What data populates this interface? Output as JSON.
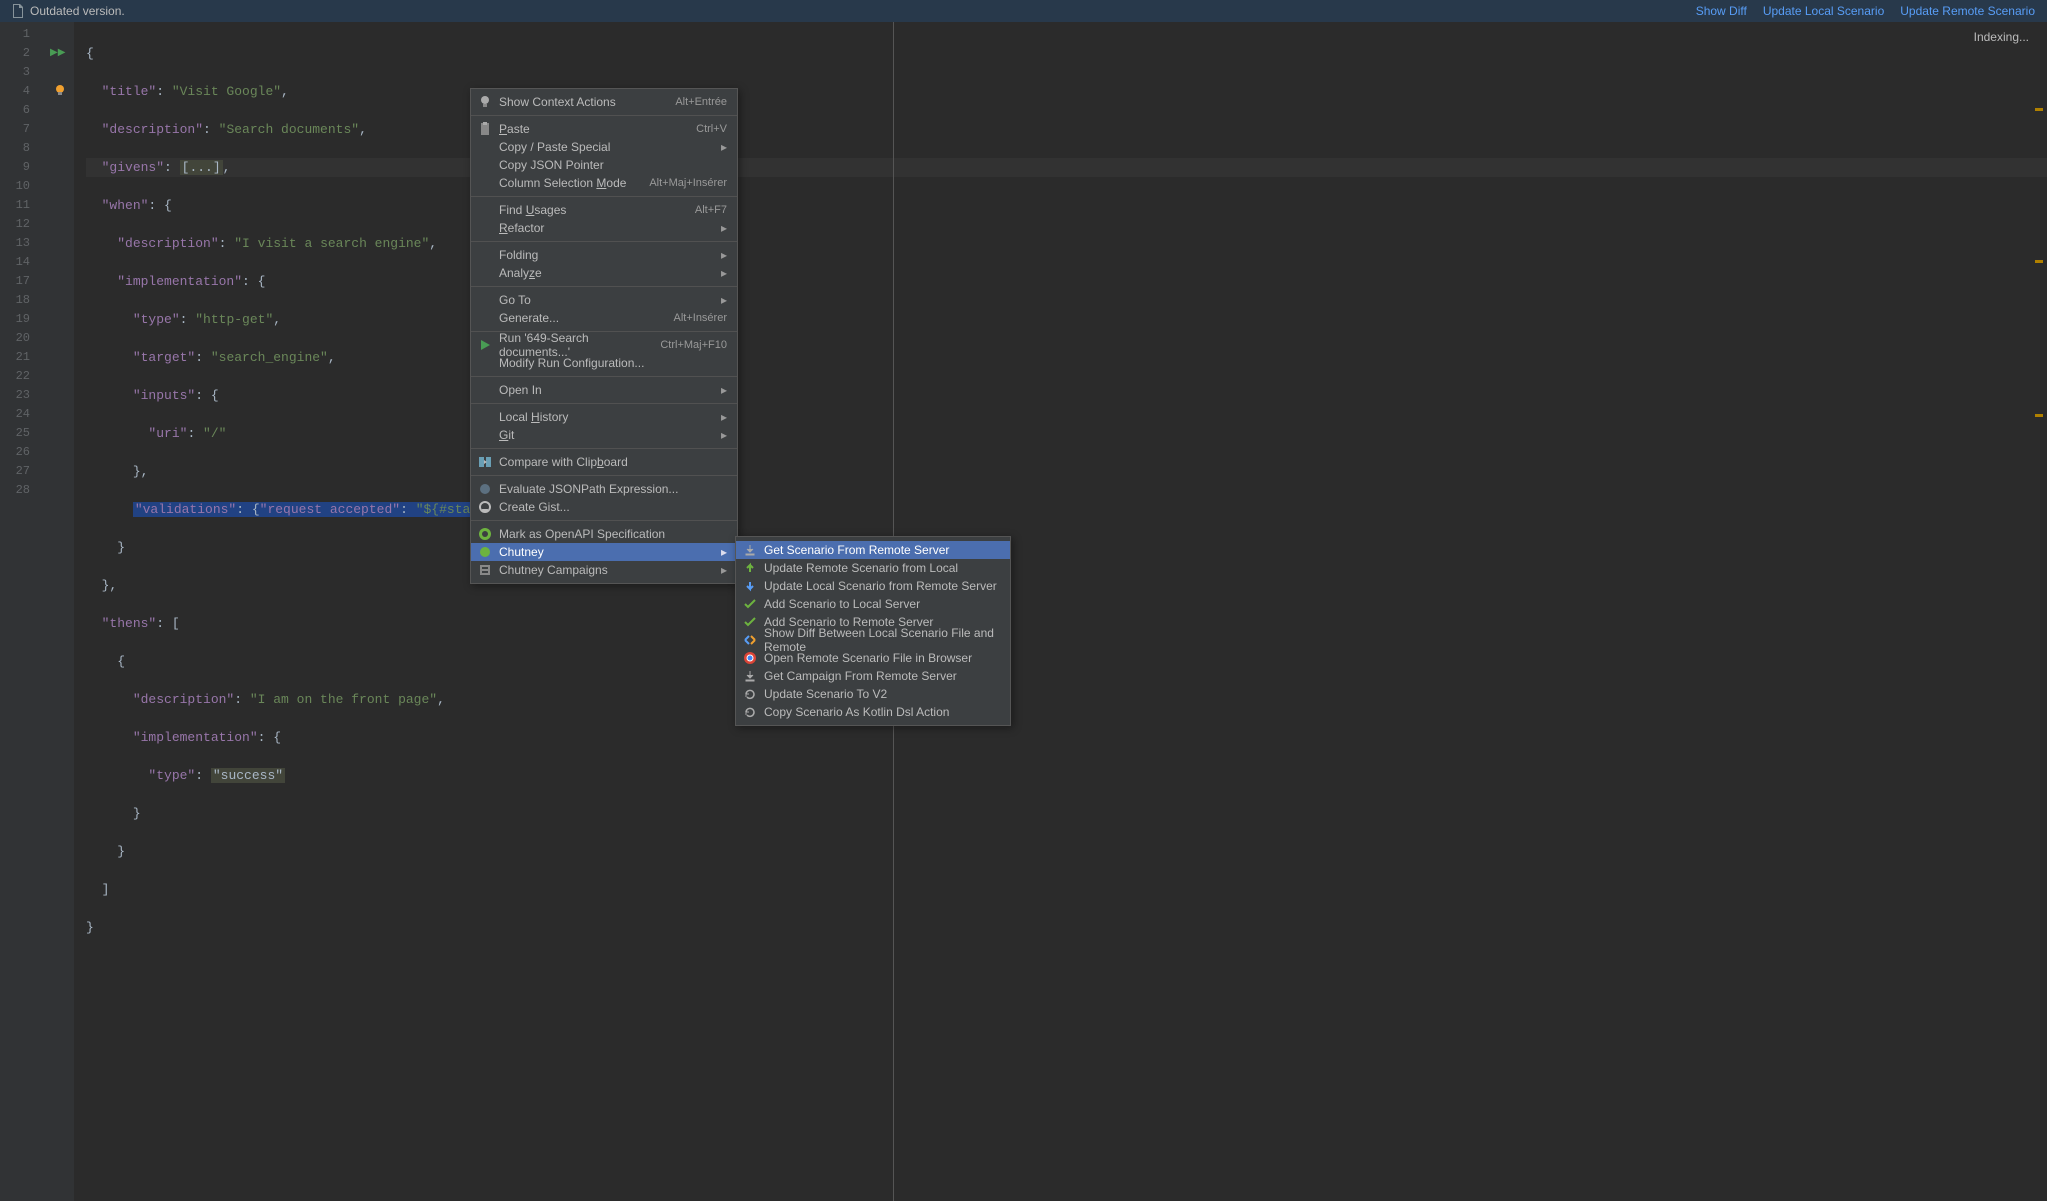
{
  "banner": {
    "message": "Outdated version.",
    "links": [
      "Show Diff",
      "Update Local Scenario",
      "Update Remote Scenario"
    ]
  },
  "status": {
    "indexing": "Indexing..."
  },
  "gutter_lines": [
    "1",
    "2",
    "3",
    "4",
    "6",
    "7",
    "8",
    "9",
    "10",
    "11",
    "12",
    "13",
    "14",
    "17",
    "18",
    "19",
    "20",
    "21",
    "22",
    "23",
    "24",
    "25",
    "26",
    "27",
    "28"
  ],
  "code": {
    "l1": "{",
    "l2_k": "\"title\"",
    "l2_s": "\"Visit Google\"",
    "l3_k": "\"description\"",
    "l3_s": "\"Search documents\"",
    "l4_k": "\"givens\"",
    "l4_box": "[...]",
    "l6_k": "\"when\"",
    "l7_k": "\"description\"",
    "l7_s": "\"I visit a search engine\"",
    "l8_k": "\"implementation\"",
    "l9_k": "\"type\"",
    "l9_s": "\"http-get\"",
    "l10_k": "\"target\"",
    "l10_s": "\"search_engine\"",
    "l11_k": "\"inputs\"",
    "l12_k": "\"uri\"",
    "l12_s": "\"/\"",
    "l14_k": "\"validations\"",
    "l14_k2": "\"request accepted\"",
    "l14_s": "\"${#status ",
    "l19_k": "\"thens\"",
    "l21_k": "\"description\"",
    "l21_s": "\"I am on the front page\"",
    "l22_k": "\"implementation\"",
    "l23_k": "\"type\"",
    "l23_box": "\"success\""
  },
  "ctx": [
    {
      "label": "Show Context Actions",
      "short": "Alt+Entrée",
      "icon": "bulb"
    },
    {
      "sep": true
    },
    {
      "label_plain": "Paste",
      "u": "P",
      "short": "Ctrl+V",
      "icon": "paste"
    },
    {
      "label": "Copy / Paste Special",
      "sub": true
    },
    {
      "label": "Copy JSON Pointer"
    },
    {
      "label_parts": [
        "Column Selection ",
        "M",
        "ode"
      ],
      "short": "Alt+Maj+Insérer"
    },
    {
      "sep": true
    },
    {
      "label_parts": [
        "Find ",
        "U",
        "sages"
      ],
      "short": "Alt+F7"
    },
    {
      "label_parts": [
        "",
        "R",
        "efactor"
      ],
      "sub": true
    },
    {
      "sep": true
    },
    {
      "label": "Folding",
      "sub": true
    },
    {
      "label_parts": [
        "Analy",
        "z",
        "e"
      ],
      "sub": true
    },
    {
      "sep": true
    },
    {
      "label": "Go To",
      "sub": true
    },
    {
      "label": "Generate...",
      "short": "Alt+Insérer"
    },
    {
      "sep": true
    },
    {
      "label": "Run '649-Search documents...'",
      "short": "Ctrl+Maj+F10",
      "icon": "run"
    },
    {
      "label": "Modify Run Configuration..."
    },
    {
      "sep": true
    },
    {
      "label": "Open In",
      "sub": true
    },
    {
      "sep": true
    },
    {
      "label_parts": [
        "Local ",
        "H",
        "istory"
      ],
      "sub": true
    },
    {
      "label_parts": [
        "",
        "G",
        "it"
      ],
      "sub": true
    },
    {
      "sep": true
    },
    {
      "label_parts": [
        "Compare with Clip",
        "b",
        "oard"
      ],
      "icon": "compare"
    },
    {
      "sep": true
    },
    {
      "label": "Evaluate JSONPath Expression...",
      "icon": "jsonpath"
    },
    {
      "label": "Create Gist...",
      "icon": "github"
    },
    {
      "sep": true
    },
    {
      "label": "Mark as OpenAPI Specification",
      "icon": "openapi"
    },
    {
      "label": "Chutney",
      "sub": true,
      "hl": true,
      "icon": "chutney"
    },
    {
      "label": "Chutney Campaigns",
      "sub": true,
      "icon": "campaigns"
    }
  ],
  "subctx": [
    {
      "label": "Get Scenario From Remote Server",
      "icon": "download",
      "hl": true
    },
    {
      "label": "Update Remote Scenario from Local",
      "icon": "upload-green"
    },
    {
      "label": "Update Local Scenario from Remote Server",
      "icon": "download-blue"
    },
    {
      "label": "Add Scenario to Local Server",
      "icon": "check"
    },
    {
      "label": "Add Scenario to Remote Server",
      "icon": "check"
    },
    {
      "label": "Show Diff Between Local Scenario File and Remote",
      "icon": "diff"
    },
    {
      "label": "Open Remote Scenario File in Browser",
      "icon": "chrome"
    },
    {
      "label": "Get Campaign From Remote Server",
      "icon": "download"
    },
    {
      "label": "Update Scenario To V2",
      "icon": "refresh"
    },
    {
      "label": "Copy Scenario As Kotlin Dsl Action",
      "icon": "refresh"
    }
  ]
}
